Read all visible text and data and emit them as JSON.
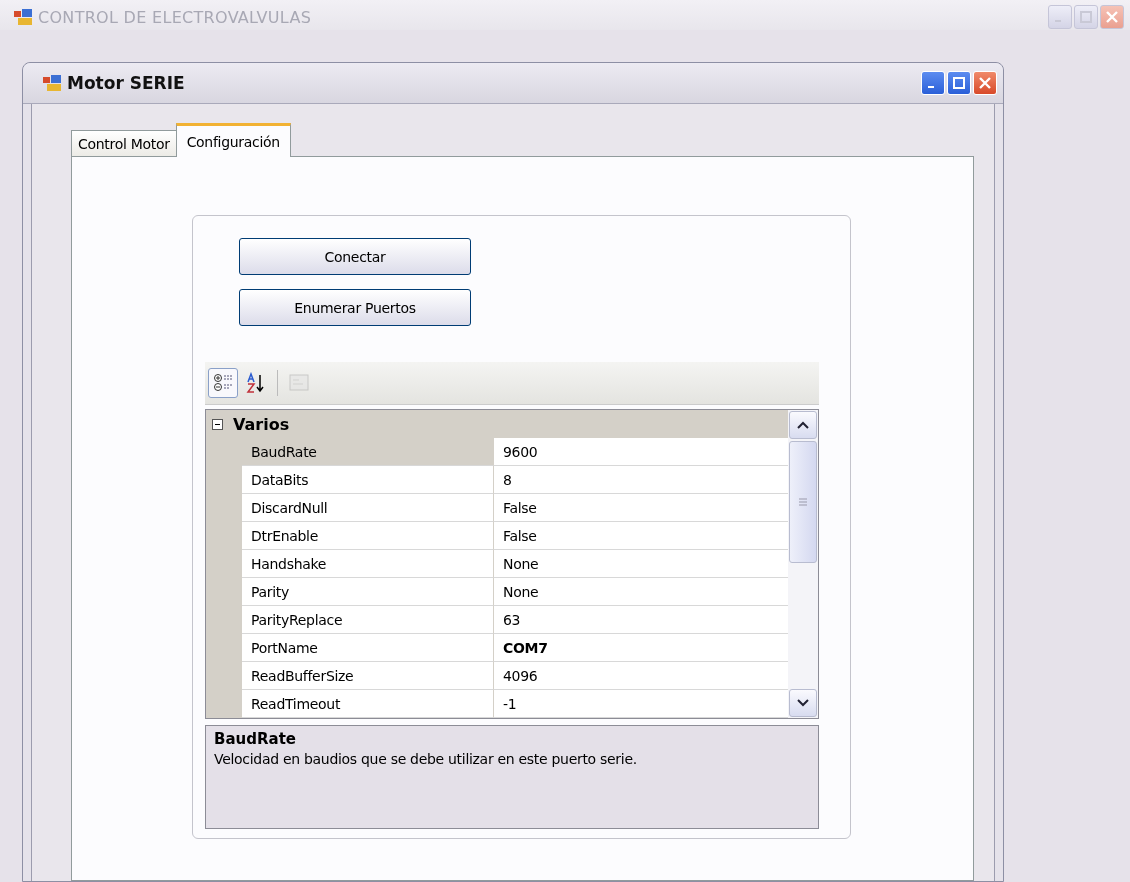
{
  "window": {
    "title": "CONTROL DE ELECTROVALVULAS",
    "active": false
  },
  "child_window": {
    "title": "Motor SERIE",
    "active": true
  },
  "tabs": [
    {
      "label": "Control Motor",
      "selected": false
    },
    {
      "label": "Configuración",
      "selected": true
    }
  ],
  "buttons": [
    "Conectar",
    "Enumerar Puertos"
  ],
  "toolbar": [
    {
      "kind": "categorized",
      "selected": true,
      "disabled": false
    },
    {
      "kind": "alphabetical",
      "selected": false,
      "disabled": false
    },
    {
      "kind": "property-pages",
      "selected": false,
      "disabled": true
    }
  ],
  "property_grid": {
    "category": {
      "label": "Varios",
      "expanded": true
    },
    "properties": [
      {
        "name": "BaudRate",
        "value": "9600",
        "selected": true,
        "modified": false
      },
      {
        "name": "DataBits",
        "value": "8",
        "selected": false,
        "modified": false
      },
      {
        "name": "DiscardNull",
        "value": "False",
        "selected": false,
        "modified": false
      },
      {
        "name": "DtrEnable",
        "value": "False",
        "selected": false,
        "modified": false
      },
      {
        "name": "Handshake",
        "value": "None",
        "selected": false,
        "modified": false
      },
      {
        "name": "Parity",
        "value": "None",
        "selected": false,
        "modified": false
      },
      {
        "name": "ParityReplace",
        "value": "63",
        "selected": false,
        "modified": false
      },
      {
        "name": "PortName",
        "value": "COM7",
        "selected": false,
        "modified": true
      },
      {
        "name": "ReadBufferSize",
        "value": "4096",
        "selected": false,
        "modified": false
      },
      {
        "name": "ReadTimeout",
        "value": "-1",
        "selected": false,
        "modified": false
      }
    ],
    "description": {
      "title": "BaudRate",
      "text": "Velocidad en baudios que se debe utilizar en este puerto serie."
    }
  }
}
